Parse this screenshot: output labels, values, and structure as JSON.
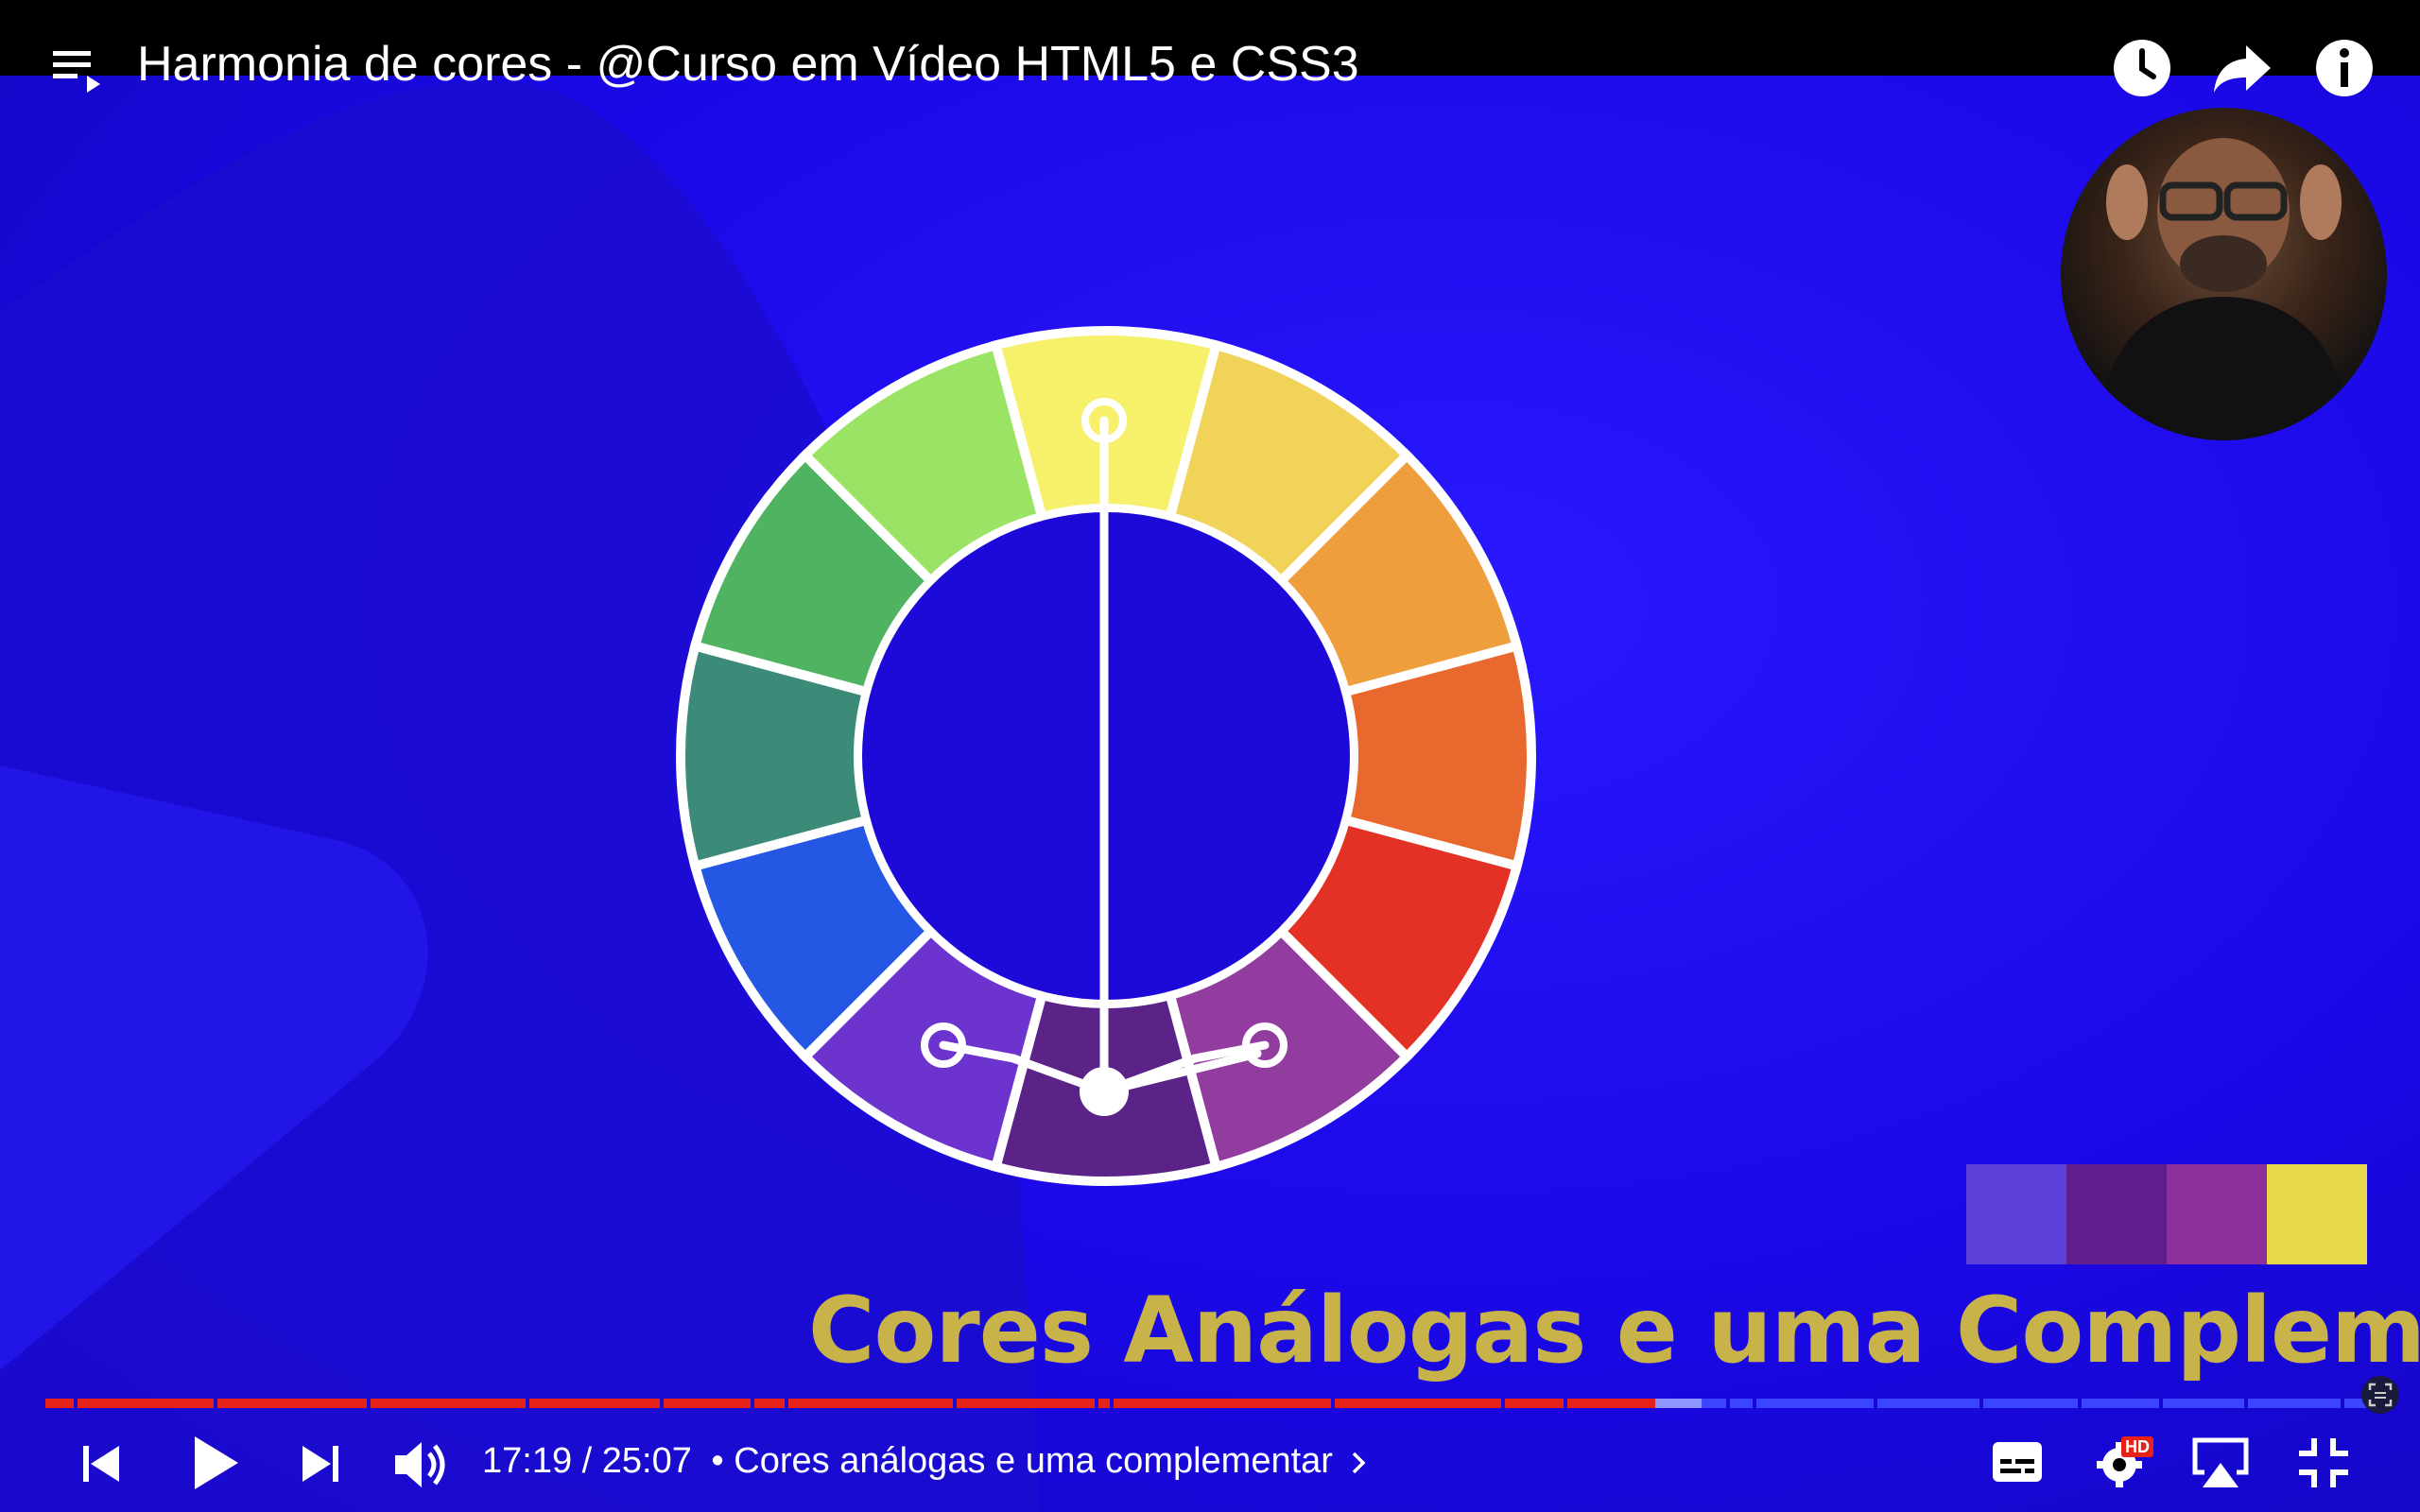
{
  "window": {
    "title": "Harmonia de cores - @Curso em Vídeo HTML5 e CSS3"
  },
  "top_icons": [
    "playlist-icon",
    "watch-later-icon",
    "share-icon",
    "info-icon"
  ],
  "video": {
    "caption": "Cores Análogas e uma Complementar",
    "palette_colors": [
      "#5c3fd6",
      "#5e1f8c",
      "#8c2f9a",
      "#e6d84a"
    ],
    "wheel_colors": [
      "#f6f06a",
      "#f2d35a",
      "#ef9e3e",
      "#e8682d",
      "#e33225",
      "#923ca0",
      "#5b2288",
      "#6c33cf",
      "#2457e3",
      "#3c8a78",
      "#4fb361",
      "#9be365"
    ]
  },
  "player": {
    "current_time": "17:19",
    "duration": "25:07",
    "time_text": "17:19 / 25:07",
    "chapter": "• Cores análogas e uma complementar",
    "progress_fraction": 0.69,
    "buffer_fraction": 0.71,
    "quality_badge": "HD"
  },
  "colors": {
    "progress": "#e62117",
    "buffer": "#8f95ff",
    "unplayed": "#3b44ff"
  }
}
